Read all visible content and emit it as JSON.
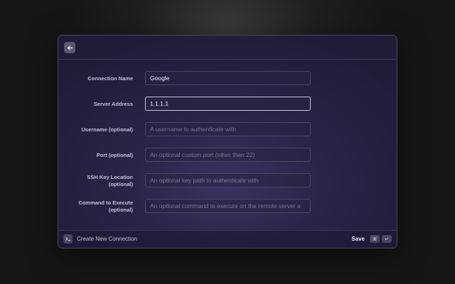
{
  "header": {
    "back_icon": "arrow-left-icon"
  },
  "form": {
    "fields": [
      {
        "label": "Connection Name",
        "value": "Google",
        "placeholder": ""
      },
      {
        "label": "Server Address",
        "value": "1.1.1.1",
        "placeholder": ""
      },
      {
        "label": "Username (optional)",
        "value": "",
        "placeholder": "A username to authenticate with"
      },
      {
        "label": "Port (optional)",
        "value": "",
        "placeholder": "An optional custom port (other than 22)"
      },
      {
        "label_line1": "SSH Key Location",
        "label_line2": "(optional)",
        "value": "",
        "placeholder": "An optional key path to authenticate with"
      },
      {
        "label_line1": "Command to Execute",
        "label_line2": "(optional)",
        "value": "",
        "placeholder": "An optional command to execute on the remote server a"
      }
    ]
  },
  "footer": {
    "icon": "terminal-icon",
    "title": "Create New Connection",
    "save_label": "Save",
    "shortcut_cmd": "⌘",
    "shortcut_enter": "↵"
  },
  "colors": {
    "window_bg": "#2a2448",
    "border": "#4a4560",
    "text": "#f0eef6",
    "muted": "#7e7896"
  }
}
